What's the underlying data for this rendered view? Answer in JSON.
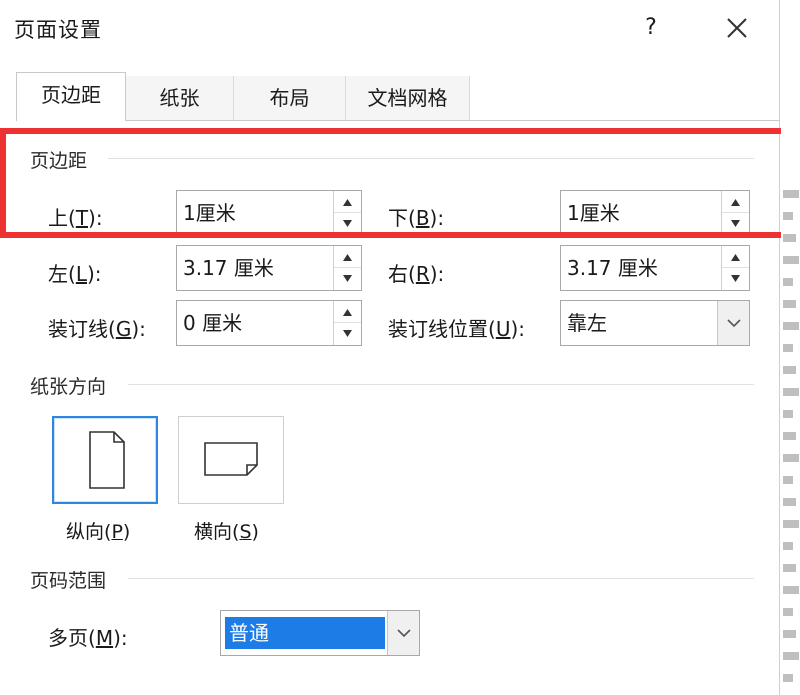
{
  "dialog": {
    "title": "页面设置",
    "help": "?"
  },
  "tabs": [
    "页边距",
    "纸张",
    "布局",
    "文档网格"
  ],
  "margins": {
    "section": "页边距",
    "top": {
      "label": "上",
      "key": "T",
      "value": "1厘米"
    },
    "bottom": {
      "label": "下",
      "key": "B",
      "value": "1厘米"
    },
    "left": {
      "label": "左",
      "key": "L",
      "value": "3.17 厘米"
    },
    "right": {
      "label": "右",
      "key": "R",
      "value": "3.17 厘米"
    },
    "gutter": {
      "label": "装订线",
      "key": "G",
      "value": "0 厘米"
    },
    "gutter_pos": {
      "label": "装订线位置",
      "key": "U",
      "value": "靠左"
    }
  },
  "orientation": {
    "section": "纸张方向",
    "portrait": {
      "label": "纵向",
      "key": "P"
    },
    "landscape": {
      "label": "横向",
      "key": "S"
    }
  },
  "pages": {
    "section": "页码范围",
    "multiple": {
      "label": "多页",
      "key": "M",
      "value": "普通"
    }
  },
  "colors": {
    "highlight": "#ee3232",
    "selection": "#1e7ce6",
    "accent": "#2e86de"
  }
}
